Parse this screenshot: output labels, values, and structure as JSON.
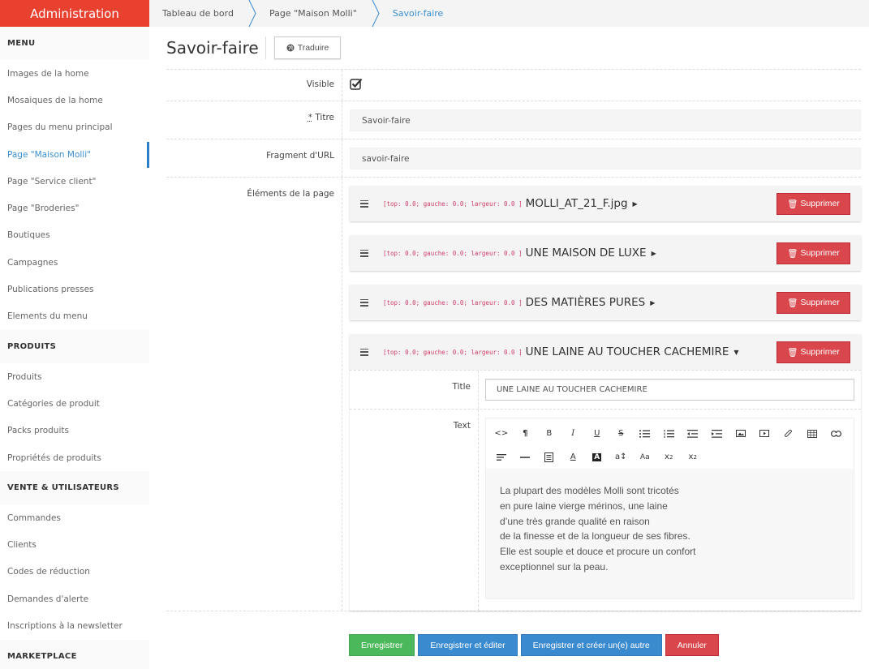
{
  "brand": {
    "title": "Administration",
    "color": "#e8412f"
  },
  "breadcrumb": [
    {
      "label": "Tableau de bord"
    },
    {
      "label": "Page \"Maison Molli\""
    },
    {
      "label": "Savoir-faire"
    }
  ],
  "sidebar": {
    "groups": [
      {
        "heading": "MENU",
        "items": [
          {
            "label": "Images de la home"
          },
          {
            "label": "Mosaiques de la home"
          },
          {
            "label": "Pages du menu principal"
          },
          {
            "label": "Page \"Maison Molli\"",
            "active": true
          },
          {
            "label": "Page \"Service client\""
          },
          {
            "label": "Page \"Broderies\""
          },
          {
            "label": "Boutiques"
          },
          {
            "label": "Campagnes"
          },
          {
            "label": "Publications presses"
          },
          {
            "label": "Elements du menu"
          }
        ]
      },
      {
        "heading": "PRODUITS",
        "items": [
          {
            "label": "Produits"
          },
          {
            "label": "Catégories de produit"
          },
          {
            "label": "Packs produits"
          },
          {
            "label": "Propriétés de produits"
          }
        ]
      },
      {
        "heading": "VENTE & UTILISATEURS",
        "items": [
          {
            "label": "Commandes"
          },
          {
            "label": "Clients"
          },
          {
            "label": "Codes de réduction"
          },
          {
            "label": "Demandes d'alerte"
          },
          {
            "label": "Inscriptions à la newsletter"
          }
        ]
      },
      {
        "heading": "MARKETPLACE",
        "items": []
      }
    ]
  },
  "page": {
    "title": "Savoir-faire",
    "translate_label": "Traduire",
    "translate_icon": "globe-icon"
  },
  "form": {
    "visible": {
      "label": "Visible",
      "checked": true
    },
    "titre": {
      "required_mark": "*",
      "label": "Titre",
      "value": "Savoir-faire"
    },
    "fragment": {
      "label": "Fragment d'URL",
      "value": "savoir-faire"
    },
    "elements_label": "Éléments de la page",
    "elements": [
      {
        "position": "[top: 0.0; gauche: 0.0; largeur: 0.0 ]",
        "title": "MOLLI_AT_21_F.jpg",
        "expanded": false,
        "delete_label": "Supprimer"
      },
      {
        "position": "[top: 0.0; gauche: 0.0; largeur: 0.0 ]",
        "title": "UNE MAISON DE LUXE",
        "expanded": false,
        "delete_label": "Supprimer"
      },
      {
        "position": "[top: 0.0; gauche: 0.0; largeur: 0.0 ]",
        "title": "DES MATIÈRES PURES",
        "expanded": false,
        "delete_label": "Supprimer"
      },
      {
        "position": "[top: 0.0; gauche: 0.0; largeur: 0.0 ]",
        "title": "UNE LAINE AU TOUCHER CACHEMIRE",
        "expanded": true,
        "delete_label": "Supprimer"
      }
    ],
    "expanded_element": {
      "title_label": "Title",
      "title_value": "UNE LAINE AU TOUCHER CACHEMIRE",
      "text_label": "Text",
      "toolbar_row1": [
        "code-view",
        "paragraph",
        "bold",
        "italic",
        "underline",
        "strikethrough",
        "unordered-list",
        "ordered-list",
        "outdent",
        "indent",
        "insert-image",
        "insert-video",
        "insert-file",
        "insert-table",
        "insert-link"
      ],
      "toolbar_row2": [
        "align-left",
        "horizontal-rule",
        "formatting-block",
        "font-color",
        "background-color",
        "font-size",
        "font-family",
        "superscript",
        "subscript"
      ],
      "text_lines": [
        "La plupart des modèles Molli sont tricotés",
        "en pure laine vierge mérinos, une laine",
        "d’une très grande qualité en raison",
        "de la finesse et de la longueur de ses fibres.",
        "Elle est souple et douce et procure un confort",
        "exceptionnel sur la peau."
      ]
    }
  },
  "actions": {
    "save": "Enregistrer",
    "save_edit": "Enregistrer et éditer",
    "save_new": "Enregistrer et créer un(e) autre",
    "cancel": "Annuler"
  },
  "colors": {
    "primary": "#3a8ad0",
    "success": "#4cb85c",
    "danger": "#d9464b",
    "position_text": "#d0406a"
  }
}
